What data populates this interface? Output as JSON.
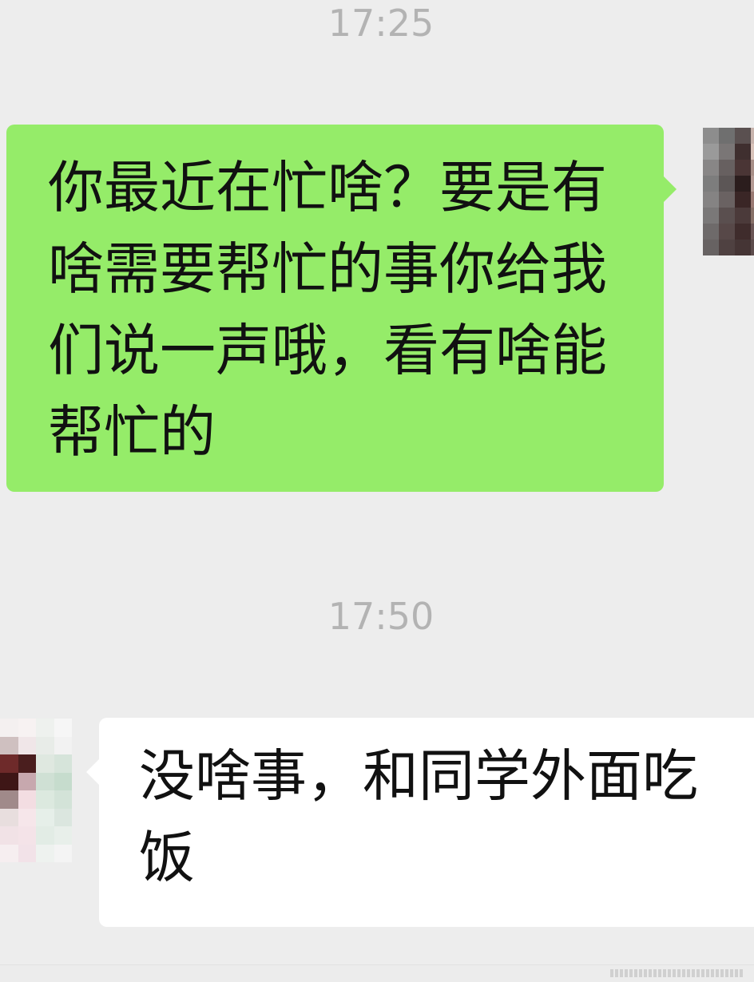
{
  "chat": {
    "messages": [
      {
        "timestamp": "17:25",
        "sender": "me",
        "text": "你最近在忙啥？要是有啥需要帮忙的事你给我们说一声哦，看有啥能帮忙的"
      },
      {
        "timestamp": "17:50",
        "sender": "friend",
        "text": "没啥事，和同学外面吃饭"
      }
    ]
  },
  "colors": {
    "background": "#ededed",
    "outgoing_bubble": "#95ec69",
    "incoming_bubble": "#ffffff",
    "timestamp_text": "#b3b3b3"
  },
  "icons": {
    "my_avatar": "avatar-pixelated",
    "friend_avatar": "avatar-pixelated"
  }
}
